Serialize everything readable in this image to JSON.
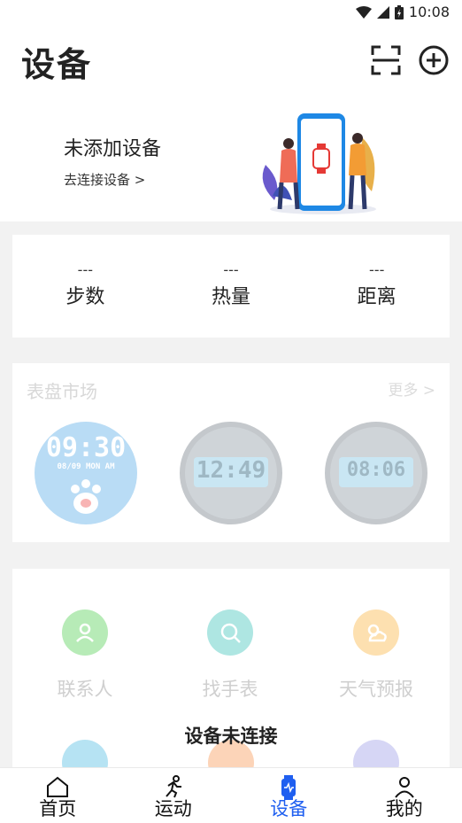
{
  "status_bar": {
    "time": "10:08"
  },
  "header": {
    "title": "设备"
  },
  "hero": {
    "title": "未添加设备",
    "link": "去连接设备 >"
  },
  "stats": [
    {
      "value": "---",
      "label": "步数"
    },
    {
      "value": "---",
      "label": "热量"
    },
    {
      "value": "---",
      "label": "距离"
    }
  ],
  "market": {
    "title": "表盘市场",
    "more": "更多 >",
    "faces": [
      {
        "time": "09:30",
        "date": "08/09 MON AM"
      },
      {
        "time": "12:49"
      },
      {
        "time": "08:06"
      }
    ]
  },
  "functions": [
    {
      "label": "联系人",
      "icon": "contact-icon",
      "color": "#b7ebb7"
    },
    {
      "label": "找手表",
      "icon": "find-watch-icon",
      "color": "#aee6e2"
    },
    {
      "label": "天气预报",
      "icon": "weather-icon",
      "color": "#fde0b0"
    }
  ],
  "overlay": {
    "message": "设备未连接"
  },
  "tabs": [
    {
      "label": "首页",
      "icon": "home-icon"
    },
    {
      "label": "运动",
      "icon": "run-icon"
    },
    {
      "label": "设备",
      "icon": "device-icon",
      "active": true
    },
    {
      "label": "我的",
      "icon": "profile-icon"
    }
  ],
  "colors": {
    "accent": "#1f5ff0"
  }
}
